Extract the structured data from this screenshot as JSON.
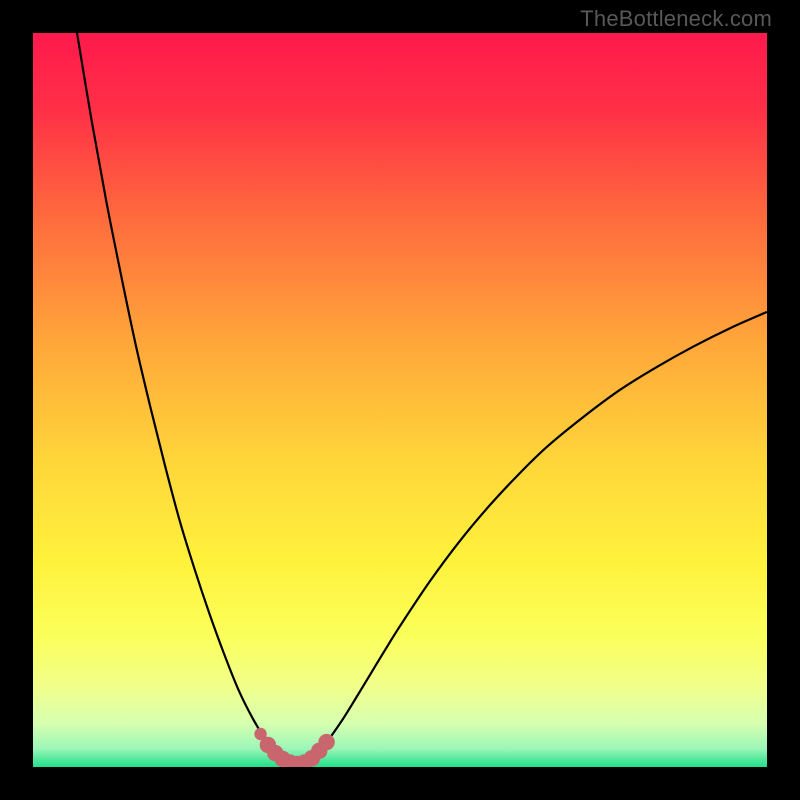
{
  "watermark": "TheBottleneck.com",
  "colors": {
    "black": "#000000",
    "gradient_top": "#ff1a4c",
    "gradient_mid_upper": "#ff7a3a",
    "gradient_mid": "#ffd53a",
    "gradient_mid_lower": "#f6ff60",
    "gradient_low": "#ccffb0",
    "gradient_bottom": "#1fe089",
    "curve_stroke": "#000000",
    "marker": "#c9656c"
  },
  "chart_data": {
    "type": "line",
    "title": "",
    "xlabel": "",
    "ylabel": "",
    "xlim": [
      0,
      100
    ],
    "ylim": [
      0,
      100
    ],
    "x": [
      6,
      8,
      10,
      12,
      14,
      16,
      18,
      20,
      22,
      24,
      26,
      28,
      30,
      32,
      33,
      34,
      35,
      36,
      37,
      38,
      40,
      42,
      44,
      46,
      48,
      50,
      54,
      58,
      62,
      66,
      70,
      75,
      80,
      85,
      90,
      95,
      100
    ],
    "values": [
      100,
      88,
      77,
      67,
      57.5,
      49,
      41,
      33.5,
      27,
      21,
      15.5,
      10.5,
      6.5,
      3.2,
      2.0,
      1.1,
      0.6,
      0.4,
      0.6,
      1.2,
      3.4,
      6.2,
      9.4,
      12.7,
      16.0,
      19.2,
      25.2,
      30.6,
      35.4,
      39.7,
      43.6,
      47.7,
      51.4,
      54.5,
      57.3,
      59.8,
      62.0
    ],
    "markers": {
      "x": [
        31.0,
        32.0,
        33.0,
        34.0,
        35.0,
        36.0,
        37.0,
        38.0,
        39.0,
        40.0
      ],
      "values": [
        4.5,
        3.0,
        1.9,
        1.1,
        0.6,
        0.4,
        0.6,
        1.2,
        2.2,
        3.4
      ]
    }
  }
}
